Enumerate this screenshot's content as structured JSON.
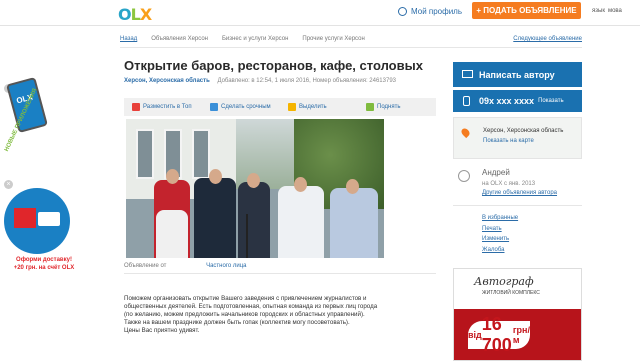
{
  "header": {
    "logo": {
      "o": "O",
      "l": "L",
      "x": "X"
    },
    "profile_label": "Мой профиль",
    "post_ad_label": "+ ПОДАТЬ ОБЪЯВЛЕНИЕ",
    "lang_1": "язык",
    "lang_2": "мова"
  },
  "breadcrumbs": {
    "items": [
      "Назад",
      "Объявления Херсон",
      "Бизнес и услуги Херсон",
      "Прочие услуги Херсон"
    ],
    "next_label": "Следующее объявление"
  },
  "listing": {
    "title": "Открытие баров, ресторанов, кафе, столовых",
    "city": "Херсон, Херсонская область",
    "meta": "Добавлено: в 12:54, 1 июля 2016, Номер объявления: 24613793",
    "actions": [
      {
        "label": "Разместить в Топ",
        "color": "#e8403a"
      },
      {
        "label": "Сделать срочным",
        "color": "#3a8fd8"
      },
      {
        "label": "Выделить",
        "color": "#f5b400"
      },
      {
        "label": "Поднять",
        "color": "#7fbb3e"
      }
    ],
    "seller_type_label": "Объявление от",
    "seller_type_value": "Частного лица",
    "description": [
      "Поможем организовать открытие Вашего заведения с привлечением журналистов и",
      "общественных деятелей. Есть подготовленная, опытная команда из первых лиц города",
      "(по желанию, можем предложить начальников городских и областных управлений).",
      "Также на вашем празднике должен быть гопак (коллектив могу посоветовать).",
      "Цены Вас приятно удивят."
    ]
  },
  "sidebar_right": {
    "write_author_label": "Написать автору",
    "phone_masked": "09х ххх хххх",
    "phone_show_label": "Показать",
    "location": "Херсон, Херсонская область",
    "map_link": "Показать на карте",
    "user_name": "Андрей",
    "user_since": "на OLX с янв. 2013",
    "other_ads_link": "Другие объявления автора",
    "links": [
      "В избранные",
      "Печать",
      "Изменить",
      "Жалоба"
    ]
  },
  "ad_banner": {
    "brand": "Автограф",
    "subtitle": "ЖИТЛОВИЙ КОМПЛЕКС",
    "price_prefix": "від",
    "price": "16 700",
    "price_unit": "грн/м"
  },
  "promos": {
    "new_apps": "НОВЫЕ ПРИЛОЖЕНИЯ",
    "phone_logo": "OLX",
    "delivery_line1": "Оформи доставку!",
    "delivery_line2": "+20 грн. на счёт OLX"
  },
  "colors": {
    "accent_blue": "#1a71b0",
    "link_blue": "#2b6ca8",
    "orange": "#f57c20"
  }
}
